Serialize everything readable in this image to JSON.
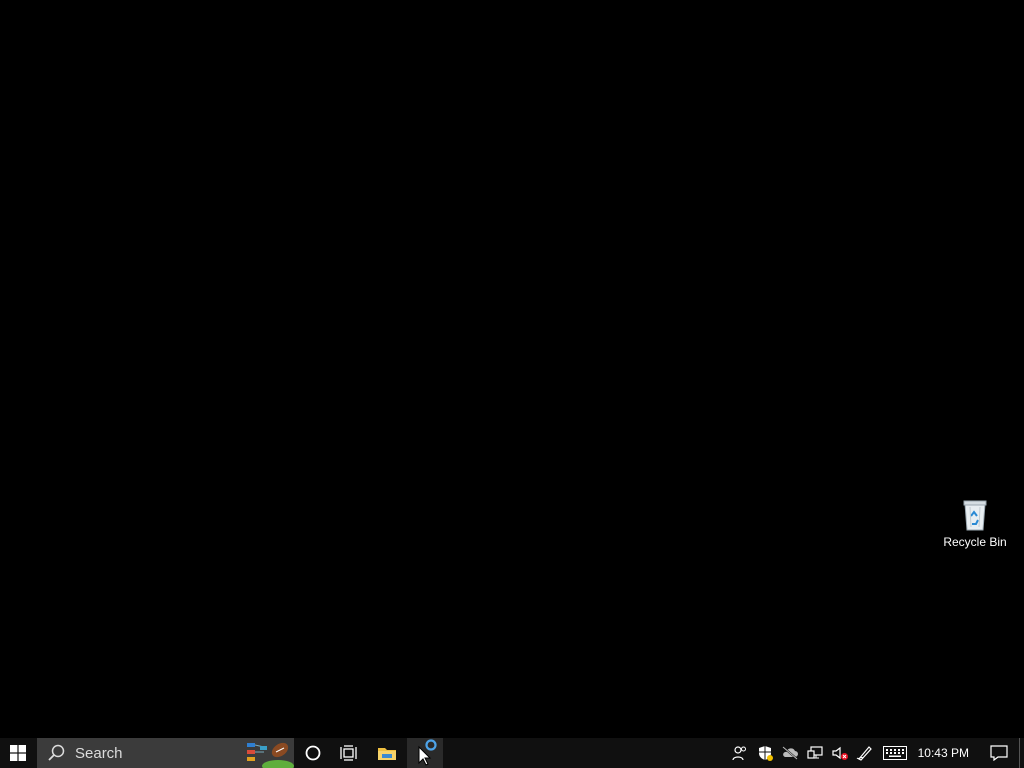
{
  "desktop": {
    "icons": [
      {
        "label": "Recycle Bin",
        "icon": "recycle-bin-icon"
      }
    ]
  },
  "taskbar": {
    "start_icon": "windows-logo-icon",
    "search": {
      "placeholder": "Search",
      "icon": "search-icon"
    },
    "cortana_icon": "cortana-circle-icon",
    "taskview_icon": "task-view-icon",
    "pinned": [
      {
        "name": "File Explorer",
        "icon": "folder-icon"
      },
      {
        "name": "Application",
        "icon": "app-icon"
      }
    ],
    "tray": {
      "icons": [
        "people-icon",
        "security-shield-icon",
        "cloud-offline-icon",
        "network-icon",
        "volume-muted-icon",
        "pen-icon",
        "keyboard-icon"
      ],
      "clock": "10:43 PM",
      "notification_icon": "action-center-icon"
    }
  },
  "colors": {
    "desktop_bg": "#000000",
    "taskbar_bg": "#101010",
    "search_bg": "#3b3b3b"
  }
}
